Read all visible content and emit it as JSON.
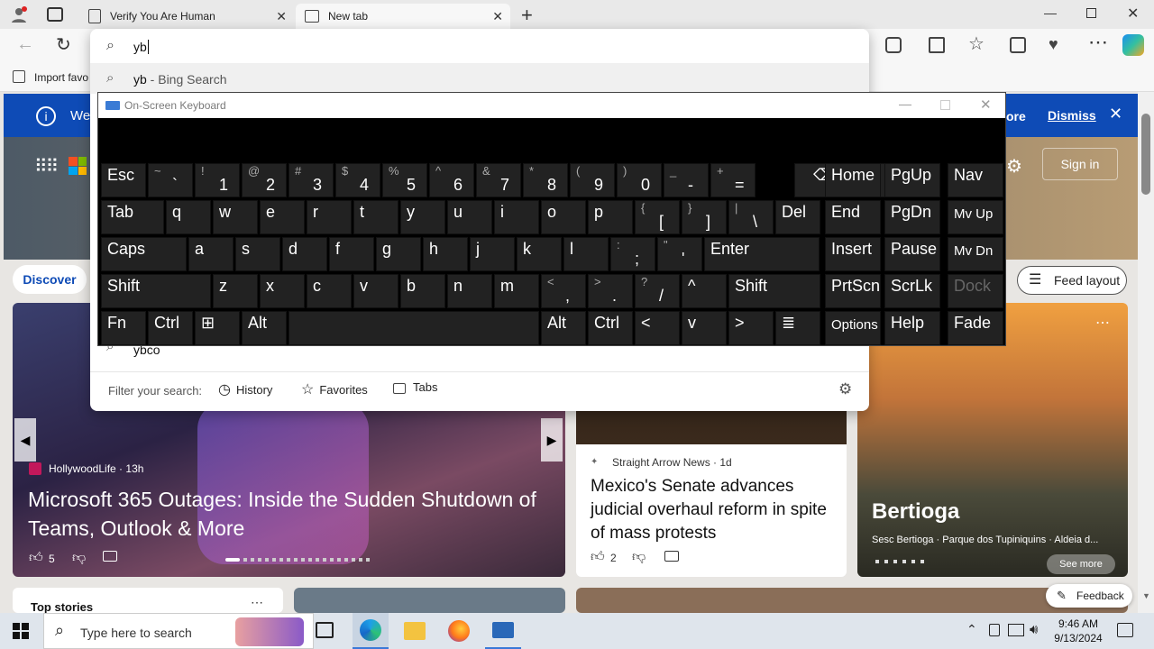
{
  "browser": {
    "tabs": [
      {
        "label": "Verify You Are Human"
      },
      {
        "label": "New tab"
      }
    ],
    "address_value": "yb",
    "fav_import": "Import favo"
  },
  "omnibox": {
    "suggestion_top": {
      "query": "yb",
      "suffix": " - Bing Search"
    },
    "suggestion_bottom": "ybco",
    "filter_label": "Filter your search:",
    "filters": [
      "History",
      "Favorites",
      "Tabs"
    ]
  },
  "banner": {
    "partial": "We'",
    "more_partial": "ore",
    "dismiss": "Dismiss"
  },
  "page": {
    "sign_in": "Sign in",
    "discover": "Discover",
    "feed_layout": "Feed layout",
    "top_stories": "Top stories"
  },
  "cards": {
    "main": {
      "source": "HollywoodLife",
      "age": "13h",
      "title": "Microsoft 365 Outages: Inside the Sudden Shutdown of Teams, Outlook & More",
      "likes": "5"
    },
    "mid": {
      "source": "Straight Arrow News",
      "age": "1d",
      "title": "Mexico's Senate advances judicial overhaul reform in spite of mass protests",
      "likes": "2"
    },
    "right": {
      "title": "Bertioga",
      "caption": "Sesc Bertioga · Parque dos Tupiniquins · Aldeia d...",
      "see_more": "See more"
    }
  },
  "feedback": "Feedback",
  "osk": {
    "title": "On-Screen Keyboard",
    "row1": [
      {
        "s": "",
        "m": "Esc"
      },
      {
        "s": "~",
        "m": "`"
      },
      {
        "s": "!",
        "m": "1"
      },
      {
        "s": "@",
        "m": "2"
      },
      {
        "s": "#",
        "m": "3"
      },
      {
        "s": "$",
        "m": "4"
      },
      {
        "s": "%",
        "m": "5"
      },
      {
        "s": "^",
        "m": "6"
      },
      {
        "s": "&",
        "m": "7"
      },
      {
        "s": "*",
        "m": "8"
      },
      {
        "s": "(",
        "m": "9"
      },
      {
        "s": ")",
        "m": "0"
      },
      {
        "s": "_",
        "m": "-"
      },
      {
        "s": "+",
        "m": "="
      }
    ],
    "row2": [
      {
        "s": "",
        "m": "Tab"
      },
      {
        "s": "",
        "m": "q"
      },
      {
        "s": "",
        "m": "w"
      },
      {
        "s": "",
        "m": "e"
      },
      {
        "s": "",
        "m": "r"
      },
      {
        "s": "",
        "m": "t"
      },
      {
        "s": "",
        "m": "y"
      },
      {
        "s": "",
        "m": "u"
      },
      {
        "s": "",
        "m": "i"
      },
      {
        "s": "",
        "m": "o"
      },
      {
        "s": "",
        "m": "p"
      },
      {
        "s": "{",
        "m": "["
      },
      {
        "s": "}",
        "m": "]"
      },
      {
        "s": "|",
        "m": "\\"
      },
      {
        "s": "",
        "m": "Del"
      }
    ],
    "row3": [
      {
        "s": "",
        "m": "Caps"
      },
      {
        "s": "",
        "m": "a"
      },
      {
        "s": "",
        "m": "s"
      },
      {
        "s": "",
        "m": "d"
      },
      {
        "s": "",
        "m": "f"
      },
      {
        "s": "",
        "m": "g"
      },
      {
        "s": "",
        "m": "h"
      },
      {
        "s": "",
        "m": "j"
      },
      {
        "s": "",
        "m": "k"
      },
      {
        "s": "",
        "m": "l"
      },
      {
        "s": ":",
        "m": ";"
      },
      {
        "s": "\"",
        "m": "'"
      },
      {
        "s": "",
        "m": "Enter"
      }
    ],
    "row4": [
      {
        "s": "",
        "m": "Shift"
      },
      {
        "s": "",
        "m": "z"
      },
      {
        "s": "",
        "m": "x"
      },
      {
        "s": "",
        "m": "c"
      },
      {
        "s": "",
        "m": "v"
      },
      {
        "s": "",
        "m": "b"
      },
      {
        "s": "",
        "m": "n"
      },
      {
        "s": "",
        "m": "m"
      },
      {
        "s": "<",
        "m": ","
      },
      {
        "s": ">",
        "m": "."
      },
      {
        "s": "?",
        "m": "/"
      },
      {
        "s": "",
        "m": "^"
      },
      {
        "s": "",
        "m": "Shift"
      }
    ],
    "row5": [
      {
        "s": "",
        "m": "Fn"
      },
      {
        "s": "",
        "m": "Ctrl"
      },
      {
        "s": "",
        "m": "⊞"
      },
      {
        "s": "",
        "m": "Alt"
      },
      {
        "s": "",
        "m": ""
      },
      {
        "s": "",
        "m": "Alt"
      },
      {
        "s": "",
        "m": "Ctrl"
      },
      {
        "s": "",
        "m": "<"
      },
      {
        "s": "",
        "m": "v"
      },
      {
        "s": "",
        "m": ">"
      },
      {
        "s": "",
        "m": "≣"
      }
    ],
    "nav": [
      "Home",
      "PgUp",
      "Nav",
      "End",
      "PgDn",
      "Mv Up",
      "Insert",
      "Pause",
      "Mv Dn",
      "PrtScn",
      "ScrLk",
      "Dock",
      "Options",
      "Help",
      "Fade"
    ]
  },
  "taskbar": {
    "search_placeholder": "Type here to search",
    "time": "9:46 AM",
    "date": "9/13/2024"
  }
}
